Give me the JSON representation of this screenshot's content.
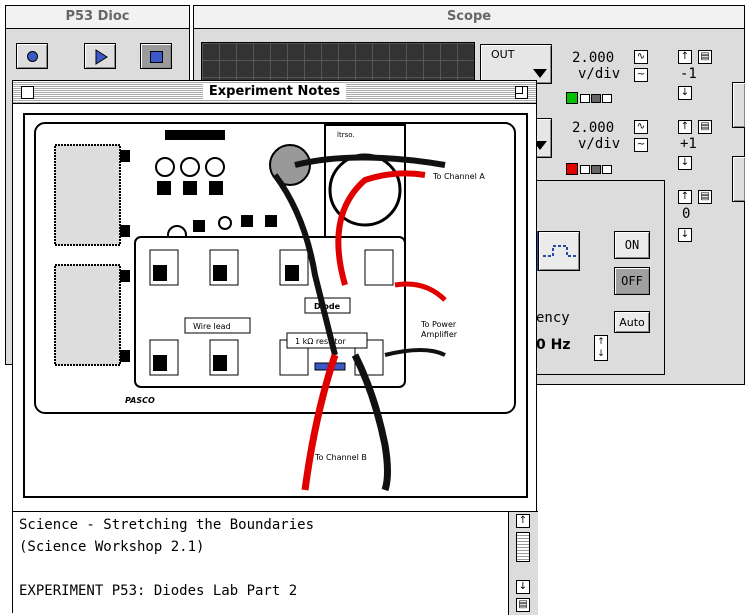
{
  "data_window": {
    "title": "P53 Dioc"
  },
  "scope": {
    "title": "Scope",
    "channel_a": {
      "input_label": "OUT",
      "value": "2.000",
      "unit": "v/div",
      "offset": "-1",
      "color": "#00c000"
    },
    "channel_b": {
      "value": "2.000",
      "unit": "v/div",
      "offset": "+1",
      "color": "#e00000"
    },
    "channel_c": {
      "offset": "0"
    }
  },
  "signal_generator": {
    "on_label": "ON",
    "off_label": "OFF",
    "auto_label": "Auto",
    "frequency_label_partial": "ency",
    "frequency_value_partial": "0 Hz"
  },
  "notes": {
    "title": "Experiment Notes",
    "diagram": {
      "to_channel_a": "To Channel A",
      "to_channel_b": "To Channel B",
      "to_power_amp_1": "To Power",
      "to_power_amp_2": "Amplifier",
      "diode": "Diode",
      "wire_lead": "Wire lead",
      "resistor": "1 kΩ resistor",
      "board_top_label": "ltrso."
    },
    "text_lines": [
      "Science - Stretching the Boundaries",
      "(Science Workshop 2.1)",
      "",
      "EXPERIMENT P53: Diodes Lab Part 2"
    ]
  }
}
